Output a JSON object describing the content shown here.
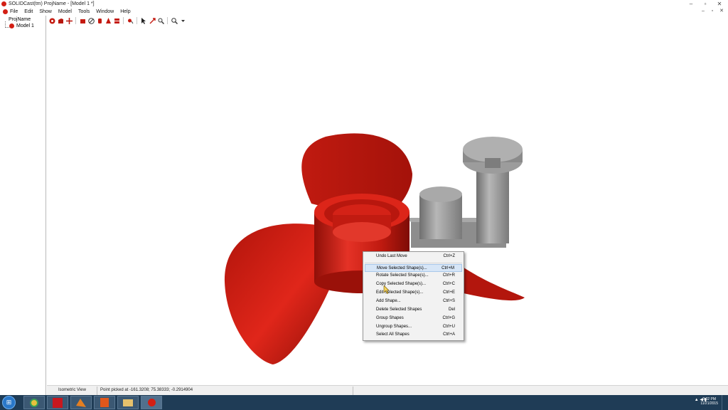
{
  "window": {
    "title": "SOLIDCast(tm) ProjName - [Model 1 *]"
  },
  "window_buttons": [
    "–",
    "▫",
    "✕"
  ],
  "menubar": {
    "items": [
      "File",
      "Edit",
      "Show",
      "Model",
      "Tools",
      "Window",
      "Help"
    ]
  },
  "mdi_buttons": [
    "–",
    "▫",
    "✕"
  ],
  "tree": {
    "root": "ProjName",
    "child": "Model 1"
  },
  "toolbar": {
    "icons": [
      "model-view-icon",
      "shaded-cube-icon",
      "move-cross-icon",
      "red-block-icon",
      "sphere-icon",
      "cylinder-icon",
      "cone-icon",
      "crank-icon",
      "rotate-icon",
      "pick-icon",
      "pan-icon",
      "zoom-window-icon",
      "zoom-icon",
      "dropdown-icon"
    ]
  },
  "viewport": {
    "model_color": "#cc1a0f",
    "riser_color": "#8e8e8e"
  },
  "context_menu": {
    "items": [
      {
        "label": "Undo Last Move",
        "shortcut": "Ctrl+Z"
      },
      {
        "label": "Move Selected Shape(s)...",
        "shortcut": "Ctrl+M"
      },
      {
        "label": "Rotate Selected Shape(s)...",
        "shortcut": "Ctrl+R"
      },
      {
        "label": "Copy Selected Shape(s)...",
        "shortcut": "Ctrl+C"
      },
      {
        "label": "Edit Selected Shape(s)...",
        "shortcut": "Ctrl+E"
      },
      {
        "label": "Add Shape...",
        "shortcut": "Ctrl+S"
      },
      {
        "label": "Delete Selected Shapes",
        "shortcut": "Del"
      },
      {
        "label": "Group Shapes",
        "shortcut": "Ctrl+G"
      },
      {
        "label": "Ungroup Shapes...",
        "shortcut": "Ctrl+U"
      },
      {
        "label": "Select All Shapes",
        "shortcut": "Ctrl+A"
      }
    ],
    "highlighted": "Move Selected Shape(s)..."
  },
  "statusbar": {
    "view": "Isometric View",
    "point": "Point picked at -161.3208; 75.38333; -0.2914904"
  },
  "taskbar": {
    "tray": "▲ ◀ ▮",
    "time": "3:02 PM",
    "date": "11/21/2015"
  },
  "colors": {
    "taskbar": "#1f3c56",
    "accent": "#d31f14"
  }
}
